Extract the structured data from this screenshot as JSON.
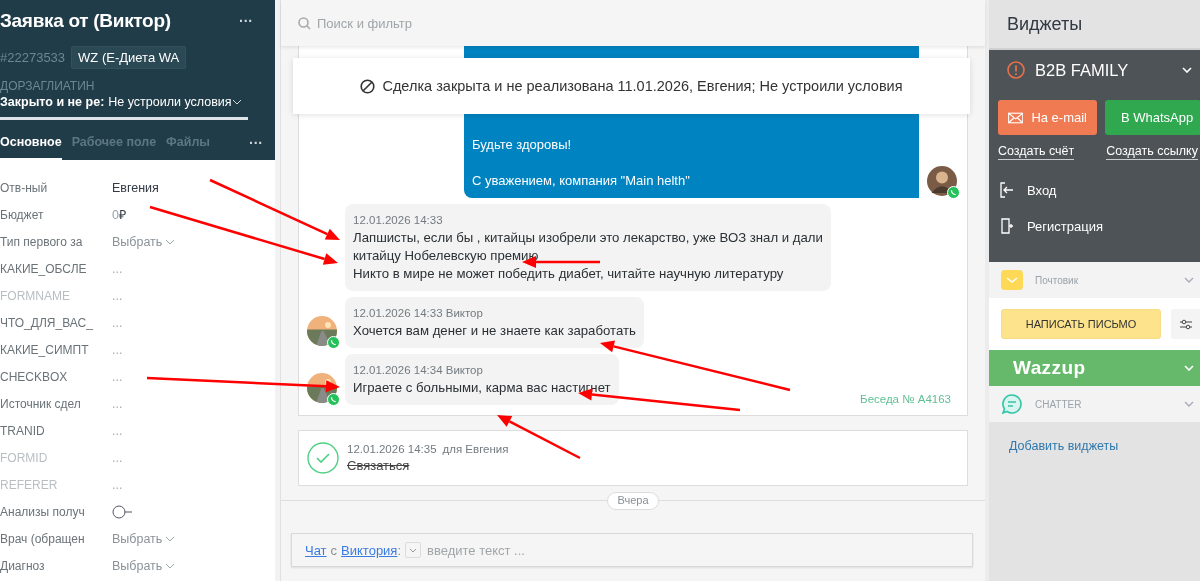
{
  "lead": {
    "title": "Заявка от (Виктор)",
    "menu": "···",
    "number": "#22273533",
    "source": "WZ (Е-Диета WA",
    "pipeline": "ДОРЗАГЛИАТИН",
    "status_prefix": "Закрыто и не ре:",
    "status": "Не устроили условия"
  },
  "tabs": [
    {
      "label": "Основное",
      "selected": true
    },
    {
      "label": "Рабочее поле",
      "selected": false
    },
    {
      "label": "Файлы",
      "selected": false
    }
  ],
  "tabs_more": "···",
  "fields": [
    {
      "label": "Отв-ный",
      "kind": "text",
      "value": "Евгения",
      "dimmed": false
    },
    {
      "label": "Бюджет",
      "kind": "money",
      "value": "0",
      "currency": "₽",
      "dimmed": false
    },
    {
      "label": "Тип первого за",
      "kind": "select",
      "placeholder": "Выбрать",
      "dimmed": false
    },
    {
      "label": "КАКИЕ_ОБСЛЕ",
      "kind": "empty",
      "placeholder": "...",
      "dimmed": false
    },
    {
      "label": "FORMNAME",
      "kind": "empty",
      "placeholder": "...",
      "dimmed": true
    },
    {
      "label": "ЧТО_ДЛЯ_ВАС_",
      "kind": "empty",
      "placeholder": "...",
      "dimmed": false
    },
    {
      "label": "КАКИЕ_СИМПТ",
      "kind": "empty",
      "placeholder": "...",
      "dimmed": false
    },
    {
      "label": "CHECKBOX",
      "kind": "empty",
      "placeholder": "...",
      "dimmed": false
    },
    {
      "label": "Источник сдел",
      "kind": "empty",
      "placeholder": "...",
      "dimmed": false
    },
    {
      "label": "TRANID",
      "kind": "empty",
      "placeholder": "...",
      "dimmed": false
    },
    {
      "label": "FORMID",
      "kind": "empty",
      "placeholder": "...",
      "dimmed": true
    },
    {
      "label": "REFERER",
      "kind": "empty",
      "placeholder": "...",
      "dimmed": true
    },
    {
      "label": "Анализы получ",
      "kind": "toggle",
      "on": false,
      "dimmed": false
    },
    {
      "label": "Врач (обращен",
      "kind": "select",
      "placeholder": "Выбрать",
      "dimmed": false
    },
    {
      "label": "Диагноз",
      "kind": "select",
      "placeholder": "Выбрать",
      "dimmed": false
    }
  ],
  "search": {
    "placeholder": "Поиск и фильтр"
  },
  "banner": "Сделка закрыта и не реализована 11.01.2026, Евгения; Не устроили условия",
  "messages": [
    {
      "kind": "outgoing",
      "text": "Будьте здоровы!\n\nС уважением, компания \"Main helth\""
    },
    {
      "kind": "incoming",
      "avatar": false,
      "meta": "12.01.2026 14:33",
      "lines": [
        "Лапшисты, если бы , китайцы изобрели это лекарство, уже ВОЗ знал и дали",
        "китайцу Нобелевскую премию",
        "Никто в мире не может победить диабет, читайте научную литературу"
      ]
    },
    {
      "kind": "incoming",
      "avatar": true,
      "meta": "12.01.2026 14:33 Виктор",
      "lines": [
        "Хочется вам денег и не знаете как заработать"
      ]
    },
    {
      "kind": "incoming",
      "avatar": true,
      "meta": "12.01.2026 14:34 Виктор",
      "lines": [
        "Играете с больными, карма вас настигнет"
      ]
    }
  ],
  "conversation": "Беседа № А4163",
  "task": {
    "date": "12.01.2026 14:35",
    "for": "для Евгения",
    "text": "Связаться",
    "done": true
  },
  "day_divider": "Вчера",
  "composer": {
    "chat_link": "Чат",
    "with": "с",
    "contact_link": "Виктория",
    "colon": ":",
    "placeholder": "введите текст ..."
  },
  "widgets": {
    "title": "Виджеты",
    "b2b": {
      "name": "B2B FAMILY",
      "email_button": "На e-mail",
      "whatsapp_button": "В WhatsApp",
      "invoice_link": "Создать счёт",
      "link_link": "Создать ссылку",
      "login": "Вход",
      "register": "Регистрация"
    },
    "mailer": {
      "name": "Почтовик",
      "button": "НАПИСАТЬ ПИСЬМО"
    },
    "wazzup": "Wazzup",
    "chatter": "CHATTER",
    "add": "Добавить виджеты"
  }
}
